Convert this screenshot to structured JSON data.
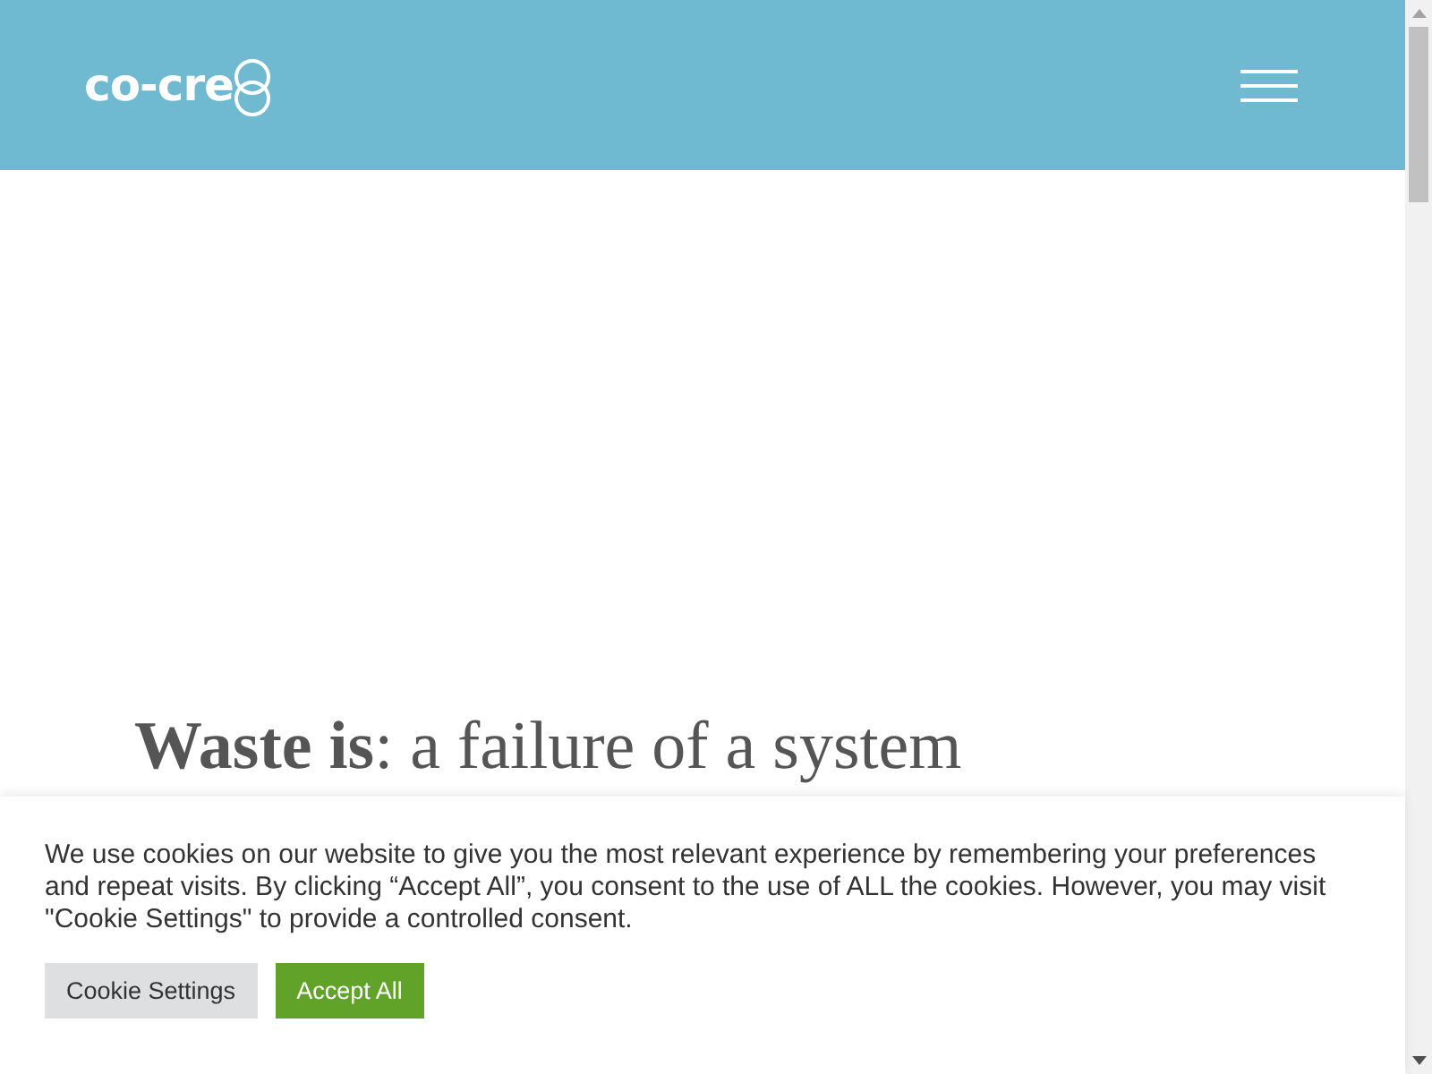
{
  "header": {
    "logo_text": "co-cre"
  },
  "heading": "**Waste is**: a failure of a system",
  "cookie_banner": {
    "message": "We use cookies on our website to give you the most relevant experience by remembering your preferences and repeat visits. By clicking “Accept All”, you consent to the use of ALL the cookies. However, you may visit \"Cookie Settings\" to provide a controlled consent.",
    "buttons": [
      {
        "label": "Cookie Settings",
        "kind": "secondary"
      },
      {
        "label": "Accept All",
        "kind": "primary"
      }
    ]
  }
}
